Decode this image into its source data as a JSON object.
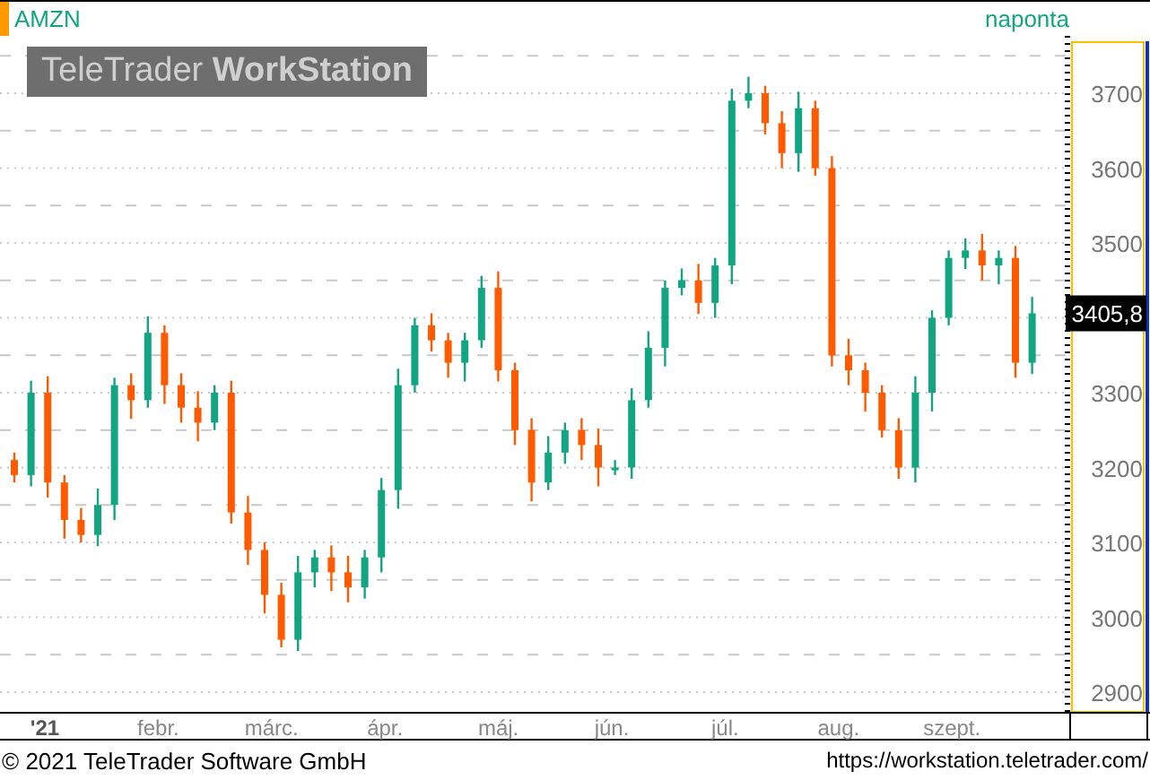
{
  "interval": "naponta",
  "logo": "TeleTrader **WorkStation**",
  "chart": {
    "last_price": "3405,8",
    "month_labels": [
      "'21",
      "febr.",
      "márc.",
      "ápr.",
      "máj.",
      "jún.",
      "júl.",
      "aug.",
      "szept."
    ],
    "chart_data": {
      "type": "candlestick",
      "title": "AMZN",
      "grid": true,
      "ylim": [
        2900,
        3700
      ],
      "yticks": [
        {
          "value": 2900,
          "label": "2900"
        },
        {
          "value": 3000,
          "label": "3000"
        },
        {
          "value": 3100,
          "label": "3100"
        },
        {
          "value": 3200,
          "label": "3200"
        },
        {
          "value": 3300,
          "label": "3300"
        },
        {
          "value": 3500,
          "label": "3500"
        },
        {
          "value": 3600,
          "label": "3600"
        },
        {
          "value": 3700,
          "label": "3700"
        }
      ],
      "ohlc": [
        [
          3210,
          3220,
          3180,
          3190
        ],
        [
          3190,
          3316,
          3175,
          3300
        ],
        [
          3300,
          3322,
          3160,
          3180
        ],
        [
          3180,
          3190,
          3105,
          3130
        ],
        [
          3130,
          3146,
          3100,
          3110
        ],
        [
          3110,
          3172,
          3095,
          3150
        ],
        [
          3150,
          3320,
          3130,
          3310
        ],
        [
          3310,
          3326,
          3265,
          3290
        ],
        [
          3290,
          3402,
          3280,
          3380
        ],
        [
          3380,
          3390,
          3285,
          3310
        ],
        [
          3310,
          3326,
          3260,
          3280
        ],
        [
          3280,
          3302,
          3235,
          3260
        ],
        [
          3260,
          3310,
          3250,
          3300
        ],
        [
          3300,
          3316,
          3125,
          3140
        ],
        [
          3140,
          3162,
          3070,
          3090
        ],
        [
          3090,
          3100,
          3005,
          3030
        ],
        [
          3030,
          3046,
          2960,
          2970
        ],
        [
          2970,
          3082,
          2955,
          3060
        ],
        [
          3060,
          3090,
          3040,
          3080
        ],
        [
          3080,
          3096,
          3035,
          3060
        ],
        [
          3060,
          3082,
          3020,
          3040
        ],
        [
          3040,
          3090,
          3025,
          3080
        ],
        [
          3080,
          3186,
          3060,
          3170
        ],
        [
          3170,
          3332,
          3145,
          3310
        ],
        [
          3310,
          3400,
          3300,
          3390
        ],
        [
          3390,
          3406,
          3355,
          3370
        ],
        [
          3370,
          3380,
          3320,
          3340
        ],
        [
          3340,
          3380,
          3315,
          3370
        ],
        [
          3370,
          3456,
          3360,
          3440
        ],
        [
          3440,
          3462,
          3315,
          3330
        ],
        [
          3330,
          3340,
          3230,
          3250
        ],
        [
          3250,
          3266,
          3155,
          3180
        ],
        [
          3180,
          3242,
          3170,
          3220
        ],
        [
          3220,
          3260,
          3205,
          3250
        ],
        [
          3250,
          3266,
          3210,
          3230
        ],
        [
          3230,
          3252,
          3175,
          3200
        ],
        [
          3200,
          3210,
          3190,
          3200
        ],
        [
          3200,
          3306,
          3185,
          3290
        ],
        [
          3290,
          3382,
          3280,
          3360
        ],
        [
          3360,
          3450,
          3335,
          3440
        ],
        [
          3440,
          3466,
          3430,
          3450
        ],
        [
          3450,
          3472,
          3405,
          3420
        ],
        [
          3420,
          3480,
          3400,
          3470
        ],
        [
          3470,
          3706,
          3445,
          3690
        ],
        [
          3690,
          3722,
          3680,
          3700
        ],
        [
          3700,
          3710,
          3645,
          3660
        ],
        [
          3660,
          3676,
          3600,
          3620
        ],
        [
          3620,
          3702,
          3595,
          3680
        ],
        [
          3680,
          3690,
          3590,
          3600
        ],
        [
          3600,
          3616,
          3335,
          3350
        ],
        [
          3350,
          3372,
          3310,
          3330
        ],
        [
          3330,
          3340,
          3275,
          3300
        ],
        [
          3300,
          3310,
          3240,
          3250
        ],
        [
          3250,
          3266,
          3185,
          3200
        ],
        [
          3200,
          3322,
          3180,
          3300
        ],
        [
          3300,
          3410,
          3275,
          3400
        ],
        [
          3400,
          3490,
          3390,
          3480
        ],
        [
          3480,
          3506,
          3465,
          3490
        ],
        [
          3490,
          3512,
          3450,
          3470
        ],
        [
          3470,
          3490,
          3445,
          3480
        ],
        [
          3480,
          3496,
          3320,
          3340
        ],
        [
          3340,
          3428,
          3325,
          3406
        ]
      ]
    }
  },
  "footer": {
    "copyright": "© 2021 TeleTrader Software GmbH",
    "url": "https://workstation.teletrader.com/"
  }
}
